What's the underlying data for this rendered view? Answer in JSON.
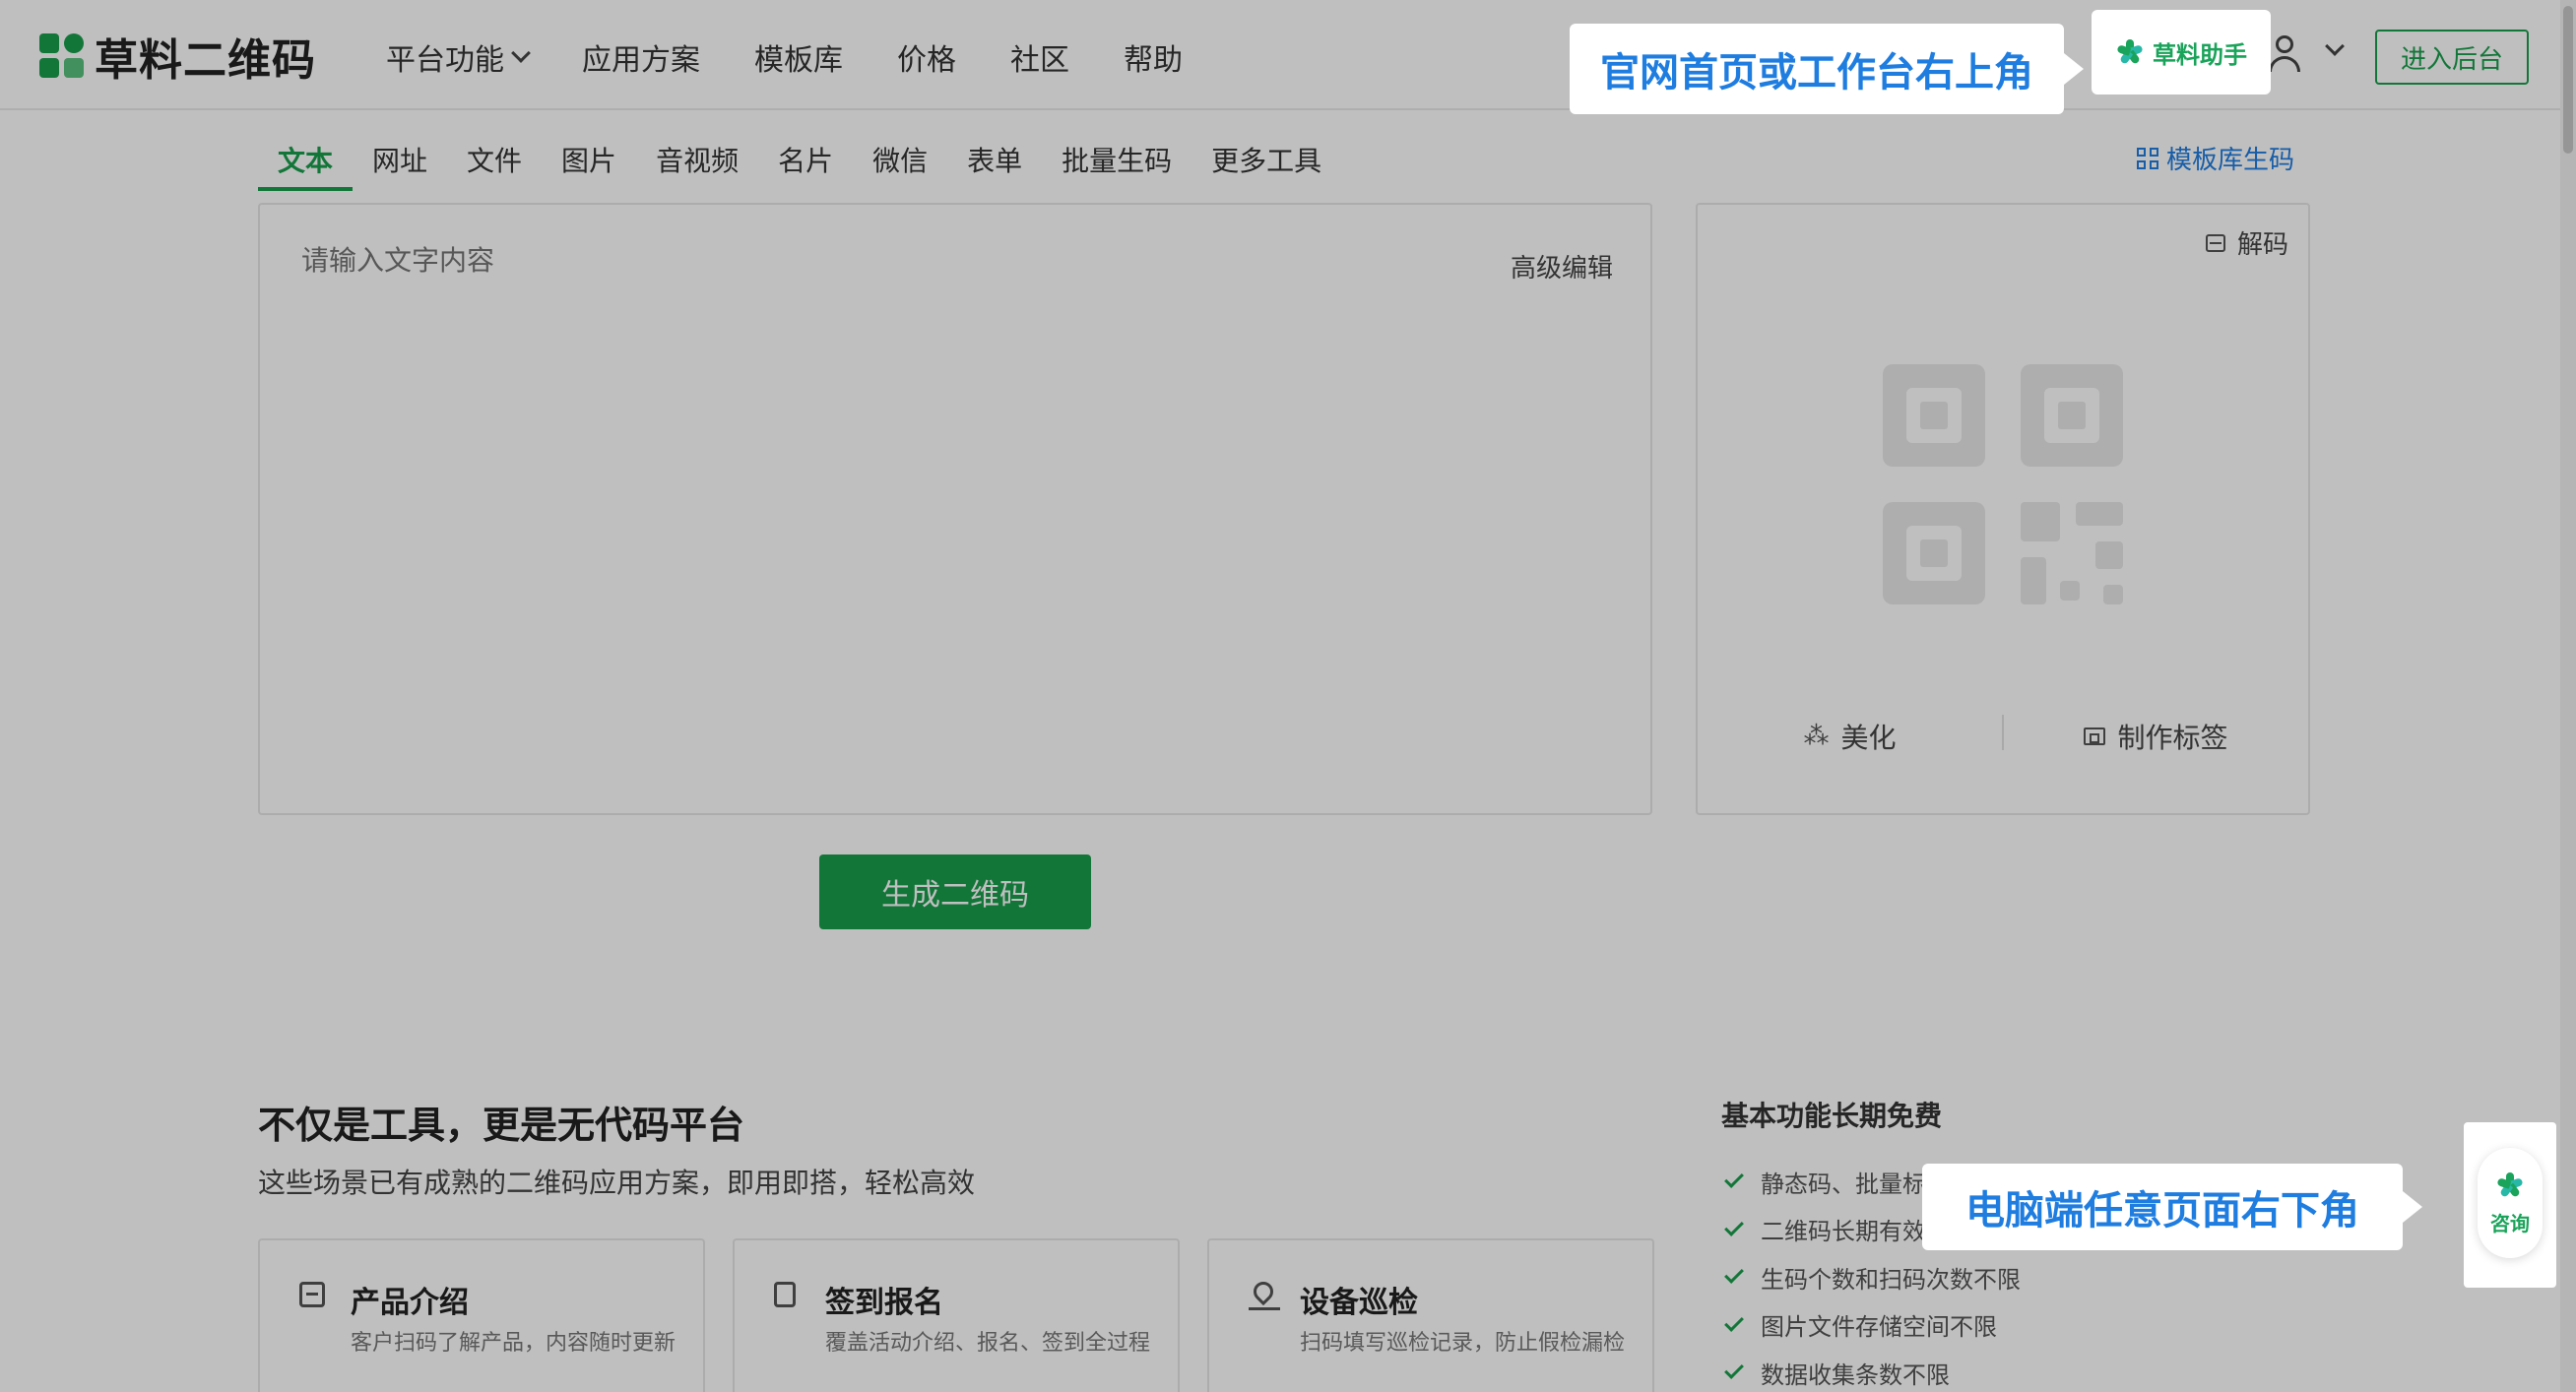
{
  "header": {
    "logo_text": "草料二维码",
    "nav": [
      {
        "label": "平台功能",
        "dropdown": true
      },
      {
        "label": "应用方案"
      },
      {
        "label": "模板库"
      },
      {
        "label": "价格"
      },
      {
        "label": "社区"
      },
      {
        "label": "帮助"
      }
    ],
    "helper_label": "草料助手",
    "enter_label": "进入后台"
  },
  "callouts": {
    "top": "官网首页或工作台右上角",
    "bottom": "电脑端任意页面右下角"
  },
  "tabs": [
    "文本",
    "网址",
    "文件",
    "图片",
    "音视频",
    "名片",
    "微信",
    "表单",
    "批量生码",
    "更多工具"
  ],
  "active_tab": "文本",
  "template_link": "模板库生码",
  "editor": {
    "placeholder": "请输入文字内容",
    "advanced_edit": "高级编辑"
  },
  "preview": {
    "decode": "解码",
    "beautify": "美化",
    "make_label": "制作标签"
  },
  "generate_button": "生成二维码",
  "lower": {
    "title": "不仅是工具，更是无代码平台",
    "subtitle": "这些场景已有成熟的二维码应用方案，即用即搭，轻松高效",
    "cards": [
      {
        "title": "产品介绍",
        "desc": "客户扫码了解产品，内容随时更新"
      },
      {
        "title": "签到报名",
        "desc": "覆盖活动介绍、报名、签到全过程"
      },
      {
        "title": "设备巡检",
        "desc": "扫码填写巡检记录，防止假检漏检"
      }
    ],
    "free_title": "基本功能长期免费",
    "free_items": [
      "静态码、批量标",
      "二维码长期有效",
      "生码个数和扫码次数不限",
      "图片文件存储空间不限",
      "数据收集条数不限"
    ]
  },
  "consult_label": "咨询",
  "colors": {
    "brand_green": "#1a9e4c",
    "callout_blue": "#1f7de0"
  }
}
